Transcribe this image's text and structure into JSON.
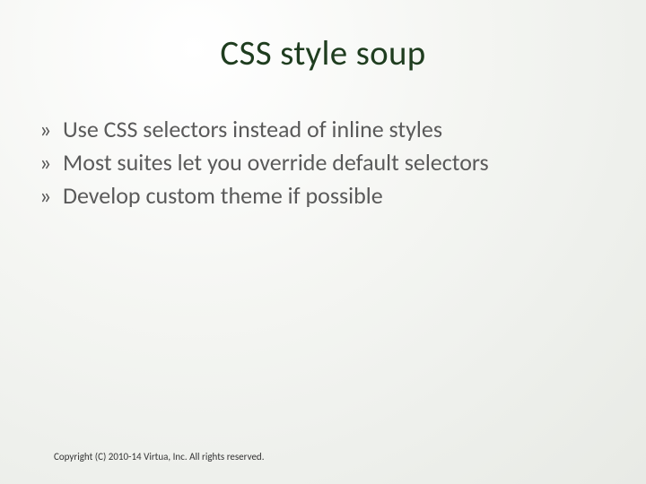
{
  "title": "CSS style soup",
  "bullets": [
    "Use CSS selectors instead of inline styles",
    "Most suites let you override default selectors",
    "Develop custom theme if possible"
  ],
  "footer": "Copyright (C) 2010-14 Virtua, Inc. All rights reserved."
}
